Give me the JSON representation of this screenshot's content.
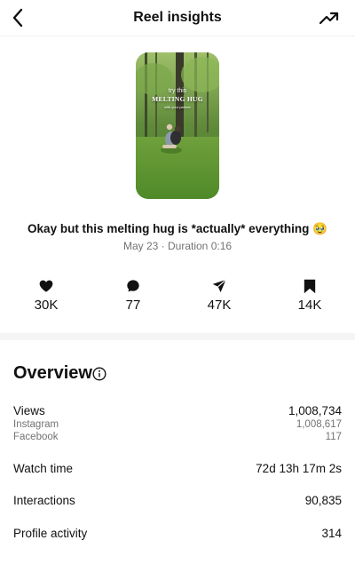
{
  "header": {
    "title": "Reel insights"
  },
  "reel": {
    "thumbnail_text": {
      "line1": "try this",
      "line2": "MELTING HUG",
      "line3": "with your partner"
    },
    "caption": "Okay but this melting hug is *actually* everything 🥹",
    "date": "May 23",
    "separator": "·",
    "duration": "Duration 0:16"
  },
  "stats": {
    "likes": "30K",
    "comments": "77",
    "shares": "47K",
    "saves": "14K"
  },
  "overview": {
    "title": "Overview",
    "views": {
      "label": "Views",
      "value": "1,008,734"
    },
    "instagram": {
      "label": "Instagram",
      "value": "1,008,617"
    },
    "facebook": {
      "label": "Facebook",
      "value": "117"
    },
    "watch_time": {
      "label": "Watch time",
      "value": "72d 13h 17m 2s"
    },
    "interactions": {
      "label": "Interactions",
      "value": "90,835"
    },
    "profile_activity": {
      "label": "Profile activity",
      "value": "314"
    }
  },
  "icons": {
    "back": "chevron-left-icon",
    "trend": "trending-up-icon",
    "like": "heart-icon",
    "comment": "comment-bubble-icon",
    "share": "paper-plane-icon",
    "save": "bookmark-icon",
    "info": "info-icon"
  }
}
